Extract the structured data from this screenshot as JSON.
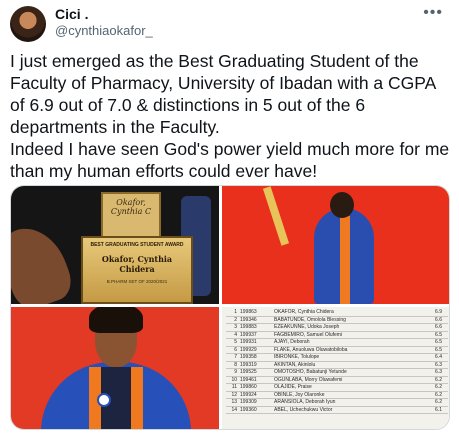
{
  "user": {
    "display_name": "Cici .",
    "handle": "@cynthiaokafor_",
    "more_icon": "more-icon"
  },
  "tweet": {
    "line1": "I just emerged as the Best Graduating Student of the Faculty of Pharmacy, University of Ibadan with a CGPA of 6.9 out of 7.0 & distinctions in 5 out of the 6 departments in the Faculty.",
    "line2": "Indeed I have seen God's power yield much more for me than my human efforts could ever have!"
  },
  "media": {
    "plaque_back_text": "Okafor, Cynthia C",
    "plaque_title": "BEST GRADUATING STUDENT AWARD",
    "plaque_name": "Okafor, Cynthia Chidera",
    "plaque_detail": "B.PHARM SET OF 2020/2021",
    "table_rows": [
      {
        "n": "1",
        "m": "199863",
        "s": "OKAFOR, Cynthia Chidera",
        "g": "6.9"
      },
      {
        "n": "2",
        "m": "199346",
        "s": "BABATUNDE, Omolola Blessing",
        "g": "6.6"
      },
      {
        "n": "3",
        "m": "199883",
        "s": "EZEAKUNNE, Udoka Joseph",
        "g": "6.6"
      },
      {
        "n": "4",
        "m": "199937",
        "s": "FAGBEMIRO, Samuel Olufemi",
        "g": "6.5"
      },
      {
        "n": "5",
        "m": "199931",
        "s": "AJAYI, Deborah",
        "g": "6.5"
      },
      {
        "n": "6",
        "m": "199929",
        "s": "FLAKE, Anuoluwa Oluwatobiloba",
        "g": "6.5"
      },
      {
        "n": "7",
        "m": "199358",
        "s": "IBIRONKE, Tolulope",
        "g": "6.4"
      },
      {
        "n": "8",
        "m": "199319",
        "s": "AKINTAN, Akinlolu",
        "g": "6.3"
      },
      {
        "n": "9",
        "m": "199525",
        "s": "OMOTOSHO, Babatunji Yetunde",
        "g": "6.3"
      },
      {
        "n": "10",
        "m": "199461",
        "s": "OGUNLABA, Morry Oluwafemi",
        "g": "6.2"
      },
      {
        "n": "11",
        "m": "199860",
        "s": "OLAJIDE, Praise",
        "g": "6.2"
      },
      {
        "n": "12",
        "m": "199924",
        "s": "OBINLE, Joy Olaronke",
        "g": "6.2"
      },
      {
        "n": "13",
        "m": "199309",
        "s": "ARANSIOLA, Deborah Iyun",
        "g": "6.2"
      },
      {
        "n": "14",
        "m": "199360",
        "s": "ABEL, Uchechukwu Victor",
        "g": "6.1"
      }
    ]
  }
}
